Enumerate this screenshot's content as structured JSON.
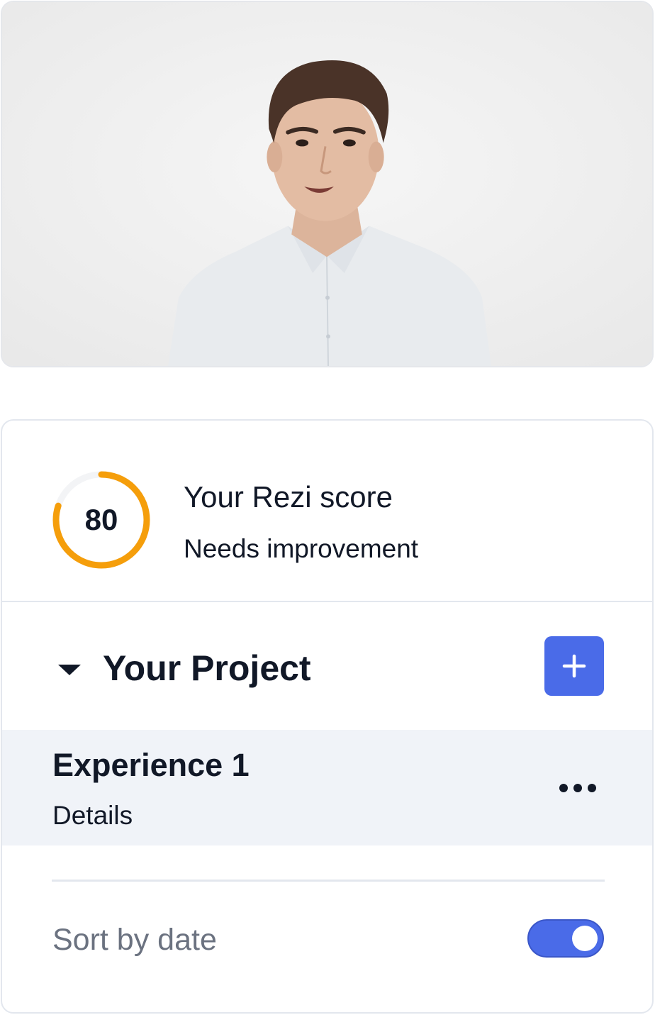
{
  "video": {
    "description_icon": "presenter-video-frame"
  },
  "score": {
    "value": "80",
    "fraction": 0.8,
    "title": "Your Rezi score",
    "status": "Needs improvement",
    "ring_color": "#f59e0b",
    "track_color": "#f3f4f6"
  },
  "project": {
    "title": "Your Project",
    "add_icon": "plus-icon",
    "expand_icon": "caret-down-icon"
  },
  "experience": {
    "title": "Experience 1",
    "subtitle": "Details",
    "menu_icon": "more-horizontal-icon"
  },
  "sort": {
    "label": "Sort by date",
    "enabled": true
  },
  "colors": {
    "accent": "#4a6be8",
    "row_highlight": "#f0f3f8",
    "border": "#e3e7ee"
  }
}
